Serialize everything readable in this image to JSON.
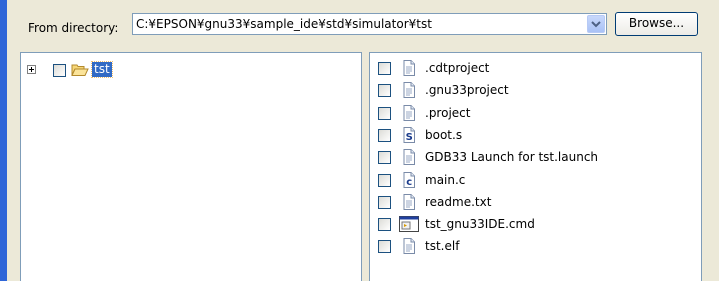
{
  "directory": {
    "label": "From directory:",
    "value": "C:¥EPSON¥gnu33¥sample_ide¥std¥simulator¥tst"
  },
  "browse_label": "Browse...",
  "tree": [
    {
      "label": "tst",
      "icon": "folder-open-icon",
      "expanded": false,
      "checked": false,
      "selected": true
    }
  ],
  "files": [
    {
      "name": ".cdtproject",
      "icon": "text-file-icon",
      "checked": false
    },
    {
      "name": ".gnu33project",
      "icon": "text-file-icon",
      "checked": false
    },
    {
      "name": ".project",
      "icon": "text-file-icon",
      "checked": false
    },
    {
      "name": "boot.s",
      "icon": "assembly-file-icon",
      "icon_glyph": "S",
      "checked": false
    },
    {
      "name": "GDB33 Launch for tst.launch",
      "icon": "text-file-icon",
      "checked": false
    },
    {
      "name": "main.c",
      "icon": "c-source-file-icon",
      "icon_glyph": "c",
      "checked": false
    },
    {
      "name": "readme.txt",
      "icon": "text-file-icon",
      "checked": false
    },
    {
      "name": "tst_gnu33IDE.cmd",
      "icon": "command-file-icon",
      "checked": false
    },
    {
      "name": "tst.elf",
      "icon": "text-file-icon",
      "checked": false
    }
  ],
  "colors": {
    "selection": "#316AC5",
    "window_bg": "#ECE9D8",
    "accent_strip": "#2F66D8"
  }
}
